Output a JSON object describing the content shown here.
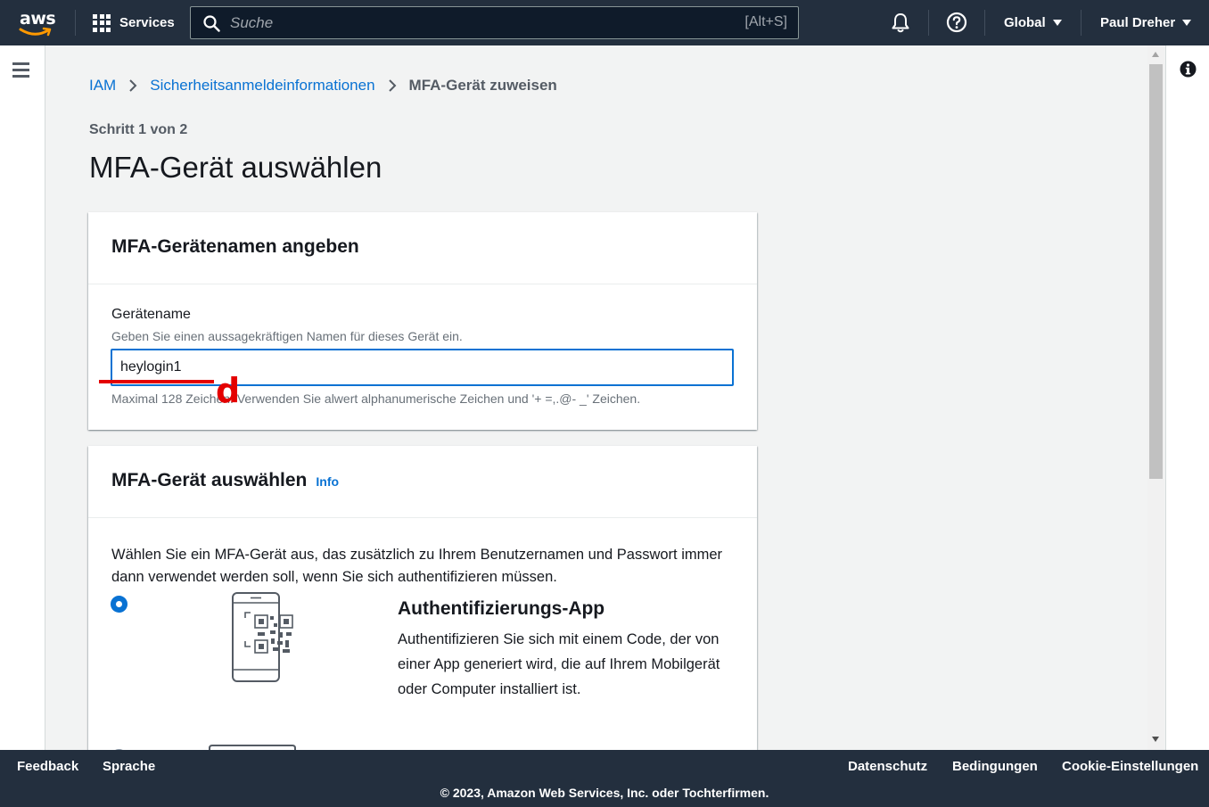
{
  "topnav": {
    "logo": "aws",
    "services_label": "Services",
    "search_placeholder": "Suche",
    "search_shortcut": "[Alt+S]",
    "region_label": "Global",
    "user_label": "Paul Dreher"
  },
  "breadcrumb": {
    "items": [
      "IAM",
      "Sicherheitsanmeldeinformationen",
      "MFA-Gerät zuweisen"
    ]
  },
  "main": {
    "step": "Schritt 1 von 2",
    "title": "MFA-Gerät auswählen"
  },
  "card_name": {
    "title": "MFA-Gerätenamen angeben",
    "field_label": "Gerätename",
    "field_description": "Geben Sie einen aussagekräftigen Namen für dieses Gerät ein.",
    "field_value": "heylogin1",
    "constraint_text": "Maximal 128 Zeichen. Verwenden Sie alwert alphanumerische Zeichen und '+ =,.@- _' Zeichen."
  },
  "annotation": {
    "letter": "d",
    "color": "#e40000"
  },
  "card_device": {
    "title": "MFA-Gerät auswählen",
    "info_link": "Info",
    "description": "Wählen Sie ein MFA-Gerät aus, das zusätzlich zu Ihrem Benutzernamen und Passwort immer dann verwendet werden soll, wenn Sie sich authentifizieren müssen.",
    "options": [
      {
        "title": "Authentifizierungs-App",
        "description": "Authentifizieren Sie sich mit einem Code, der von einer App generiert wird, die auf Ihrem Mobilgerät oder Computer installiert ist.",
        "selected": true,
        "icon": "qr-phone-icon"
      }
    ]
  },
  "footer": {
    "feedback": "Feedback",
    "language": "Sprache",
    "privacy": "Datenschutz",
    "terms": "Bedingungen",
    "cookies": "Cookie-Einstellungen",
    "copyright": "© 2023, Amazon Web Services, Inc. oder Tochterfirmen."
  },
  "colors": {
    "nav_bg": "#232f3e",
    "link": "#0972d3",
    "annotation": "#e40000"
  }
}
